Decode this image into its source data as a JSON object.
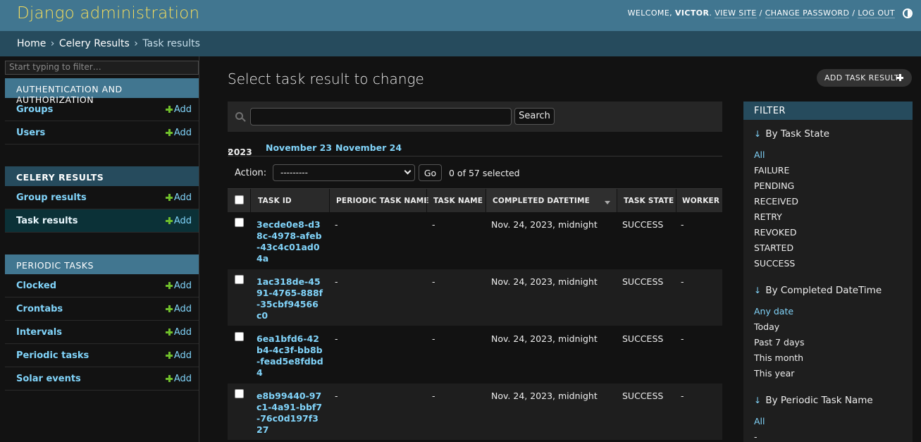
{
  "header": {
    "site_name": "Django administration",
    "welcome": "WELCOME,",
    "username": "VICTOR",
    "view_site": "VIEW SITE",
    "change_password": "CHANGE PASSWORD",
    "log_out": "LOG OUT"
  },
  "breadcrumbs": {
    "home": "Home",
    "app": "Celery Results",
    "current": "Task results",
    "sep": "›"
  },
  "sidebar": {
    "filter_placeholder": "Start typing to filter…",
    "add_label": "Add",
    "modules": [
      {
        "caption": "AUTHENTICATION AND AUTHORIZATION",
        "models": [
          "Groups",
          "Users"
        ]
      },
      {
        "caption": "CELERY RESULTS",
        "models": [
          "Group results",
          "Task results"
        ]
      },
      {
        "caption": "PERIODIC TASKS",
        "models": [
          "Clocked",
          "Crontabs",
          "Intervals",
          "Periodic tasks",
          "Solar events"
        ]
      }
    ]
  },
  "content": {
    "title": "Select task result to change",
    "add_button": "ADD TASK RESULT",
    "search_button": "Search",
    "date_hierarchy": {
      "back": "2023",
      "back_icon": "‹",
      "links": [
        "November 23",
        "November 24"
      ]
    },
    "action_label": "Action:",
    "action_selected": "---------",
    "go_button": "Go",
    "selected_counter": "0 of 57 selected"
  },
  "table": {
    "headers": [
      "TASK ID",
      "PERIODIC TASK NAME",
      "TASK NAME",
      "COMPLETED DATETIME",
      "TASK STATE",
      "WORKER"
    ],
    "rows": [
      {
        "task_id": "3ecde0e8-d38c-4978-afeb-43c4c01ad04a",
        "periodic_task_name": "-",
        "task_name": "-",
        "completed": "Nov. 24, 2023, midnight",
        "state": "SUCCESS",
        "worker": "-"
      },
      {
        "task_id": "1ac318de-4591-4765-888f-35cbf94566c0",
        "periodic_task_name": "-",
        "task_name": "-",
        "completed": "Nov. 24, 2023, midnight",
        "state": "SUCCESS",
        "worker": "-"
      },
      {
        "task_id": "6ea1bfd6-42b4-4c3f-bb8b-fead5e8fdbd4",
        "periodic_task_name": "-",
        "task_name": "-",
        "completed": "Nov. 24, 2023, midnight",
        "state": "SUCCESS",
        "worker": "-"
      },
      {
        "task_id": "e8b99440-97c1-4a91-bbf7-76c0d197f327",
        "periodic_task_name": "-",
        "task_name": "-",
        "completed": "Nov. 24, 2023, midnight",
        "state": "SUCCESS",
        "worker": "-"
      }
    ]
  },
  "filter": {
    "title": "FILTER",
    "arrow": "↓",
    "sections": [
      {
        "heading": "By Task State",
        "items": [
          "All",
          "FAILURE",
          "PENDING",
          "RECEIVED",
          "RETRY",
          "REVOKED",
          "STARTED",
          "SUCCESS"
        ],
        "selected": "All"
      },
      {
        "heading": "By Completed DateTime",
        "items": [
          "Any date",
          "Today",
          "Past 7 days",
          "This month",
          "This year"
        ],
        "selected": "Any date"
      },
      {
        "heading": "By Periodic Task Name",
        "items": [
          "All",
          "-"
        ],
        "selected": "All"
      }
    ]
  },
  "colors": {
    "header": "#417690",
    "brand": "#f5dd5d",
    "link": "#81d4fa",
    "add_green": "#70bf2b",
    "breadcrumbs": "#264b5d"
  }
}
